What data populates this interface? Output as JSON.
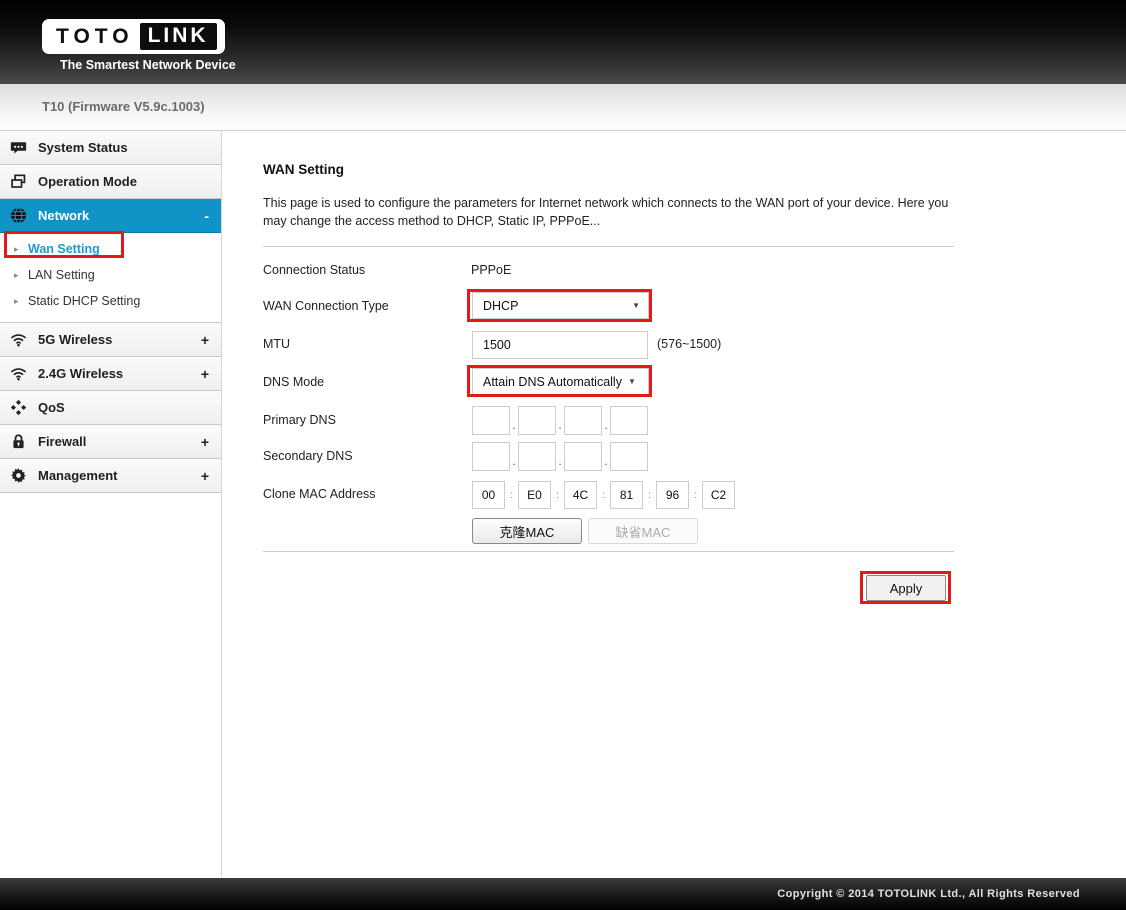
{
  "header": {
    "logo_primary": "TOTO",
    "logo_secondary": "LINK",
    "tagline": "The Smartest Network Device"
  },
  "firmware_bar": {
    "text": "T10 (Firmware V5.9c.1003)"
  },
  "sidebar": {
    "bullet": "▸",
    "items": [
      {
        "label": "System Status",
        "icon": "chat-icon",
        "expand": ""
      },
      {
        "label": "Operation Mode",
        "icon": "windows-icon",
        "expand": ""
      },
      {
        "label": "Network",
        "icon": "globe-icon",
        "expand": "-",
        "active": true
      },
      {
        "label": "5G Wireless",
        "icon": "wifi-icon",
        "expand": "+"
      },
      {
        "label": "2.4G Wireless",
        "icon": "wifi-icon",
        "expand": "+"
      },
      {
        "label": "QoS",
        "icon": "diamonds-icon",
        "expand": ""
      },
      {
        "label": "Firewall",
        "icon": "lock-icon",
        "expand": "+"
      },
      {
        "label": "Management",
        "icon": "gear-icon",
        "expand": "+"
      }
    ],
    "network_submenu": [
      {
        "label": "Wan Setting",
        "active": true
      },
      {
        "label": "LAN Setting"
      },
      {
        "label": "Static DHCP Setting"
      }
    ]
  },
  "main": {
    "title": "WAN Setting",
    "description": "This page is used to configure the parameters for Internet network which connects to the WAN port of your device. Here you may change the access method to DHCP, Static IP, PPPoE...",
    "fields": {
      "connection_status_label": "Connection Status",
      "connection_status_value": "PPPoE",
      "wan_type_label": "WAN Connection Type",
      "wan_type_value": "DHCP",
      "mtu_label": "MTU",
      "mtu_value": "1500",
      "mtu_hint": "(576~1500)",
      "dns_mode_label": "DNS Mode",
      "dns_mode_value": "Attain DNS Automatically",
      "primary_dns_label": "Primary DNS",
      "secondary_dns_label": "Secondary DNS",
      "clone_mac_label": "Clone MAC Address",
      "mac_octets": [
        "00",
        "E0",
        "4C",
        "81",
        "96",
        "C2"
      ]
    },
    "separators": {
      "dns_dot": ".",
      "mac_colon": ":"
    },
    "icons": {
      "dropdown_arrow": "▼"
    },
    "buttons": {
      "clone_mac": "克隆MAC",
      "default_mac": "缺省MAC",
      "apply": "Apply"
    }
  },
  "footer": {
    "copyright": "Copyright © 2014 TOTOLINK Ltd.,  All Rights Reserved"
  },
  "colors": {
    "accent_blue": "#1093c6",
    "link_blue": "#1b9cd5",
    "annotation_red": "#e01b1b"
  }
}
